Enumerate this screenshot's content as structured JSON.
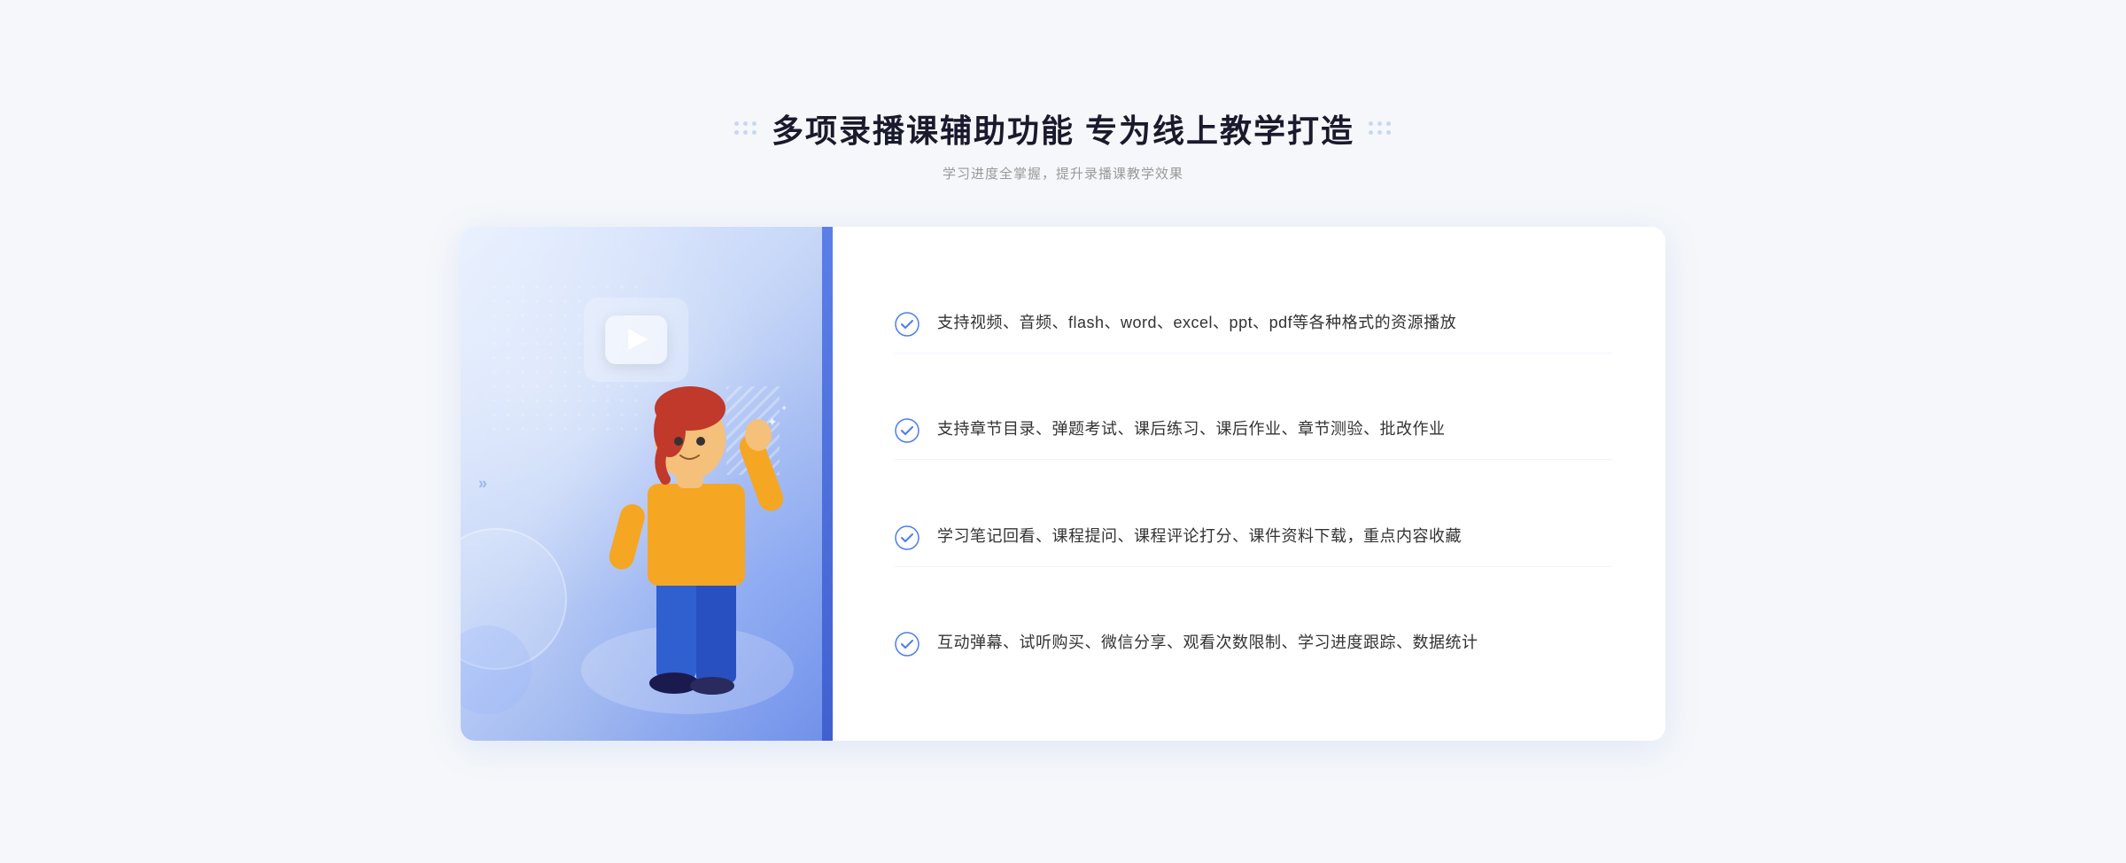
{
  "header": {
    "title": "多项录播课辅助功能 专为线上教学打造",
    "subtitle": "学习进度全掌握，提升录播课教学效果",
    "dots_decoration": "grid-dots"
  },
  "features": [
    {
      "id": 1,
      "text": "支持视频、音频、flash、word、excel、ppt、pdf等各种格式的资源播放"
    },
    {
      "id": 2,
      "text": "支持章节目录、弹题考试、课后练习、课后作业、章节测验、批改作业"
    },
    {
      "id": 3,
      "text": "学习笔记回看、课程提问、课程评论打分、课件资料下载，重点内容收藏"
    },
    {
      "id": 4,
      "text": "互动弹幕、试听购买、微信分享、观看次数限制、学习进度跟踪、数据统计"
    }
  ],
  "illustration": {
    "play_button_label": "play",
    "panel_background": "gradient-blue"
  },
  "colors": {
    "primary_blue": "#4b7cf3",
    "light_blue": "#e8f0ff",
    "check_color": "#4b7cf3",
    "title_color": "#1a1a2e",
    "text_color": "#333333",
    "subtitle_color": "#999999"
  }
}
